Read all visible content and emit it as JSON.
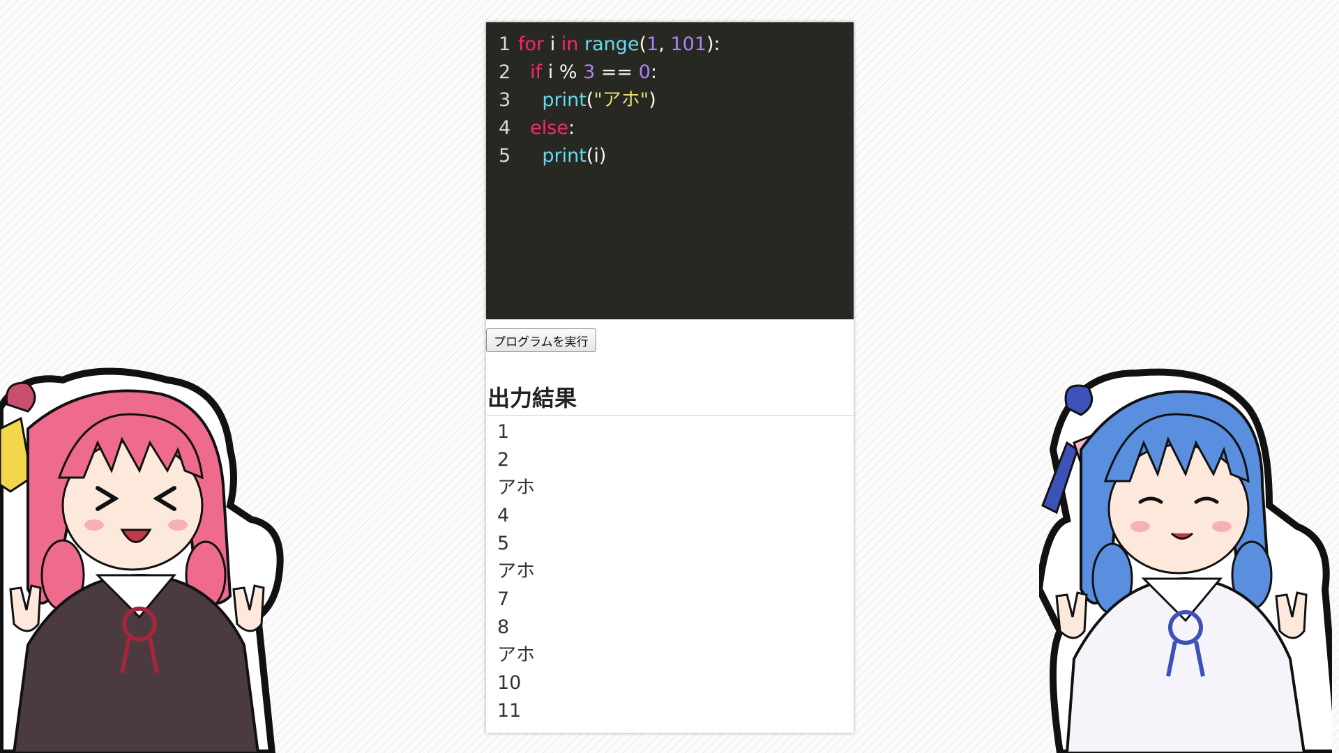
{
  "editor": {
    "lines": [
      {
        "num": "1",
        "tokens": [
          {
            "t": "for",
            "c": "kw"
          },
          {
            "t": " i ",
            "c": "plain"
          },
          {
            "t": "in",
            "c": "kw"
          },
          {
            "t": " ",
            "c": "plain"
          },
          {
            "t": "range",
            "c": "fn"
          },
          {
            "t": "(",
            "c": "plain"
          },
          {
            "t": "1",
            "c": "num"
          },
          {
            "t": ", ",
            "c": "plain"
          },
          {
            "t": "101",
            "c": "num"
          },
          {
            "t": "):",
            "c": "plain"
          }
        ]
      },
      {
        "num": "2",
        "tokens": [
          {
            "t": "  ",
            "c": "plain"
          },
          {
            "t": "if",
            "c": "kw"
          },
          {
            "t": " i % ",
            "c": "plain"
          },
          {
            "t": "3",
            "c": "num"
          },
          {
            "t": " == ",
            "c": "plain"
          },
          {
            "t": "0",
            "c": "num"
          },
          {
            "t": ":",
            "c": "plain"
          }
        ]
      },
      {
        "num": "3",
        "tokens": [
          {
            "t": "    ",
            "c": "plain"
          },
          {
            "t": "print",
            "c": "fn"
          },
          {
            "t": "(",
            "c": "plain"
          },
          {
            "t": "\"アホ\"",
            "c": "str"
          },
          {
            "t": ")",
            "c": "plain"
          }
        ]
      },
      {
        "num": "4",
        "tokens": [
          {
            "t": "  ",
            "c": "plain"
          },
          {
            "t": "else",
            "c": "kw"
          },
          {
            "t": ":",
            "c": "plain"
          }
        ]
      },
      {
        "num": "5",
        "tokens": [
          {
            "t": "    ",
            "c": "plain"
          },
          {
            "t": "print",
            "c": "fn"
          },
          {
            "t": "(i)",
            "c": "plain"
          }
        ]
      }
    ]
  },
  "run_button": {
    "label": "プログラムを実行"
  },
  "output": {
    "heading": "出力結果",
    "lines": [
      "1",
      "2",
      "アホ",
      "4",
      "5",
      "アホ",
      "7",
      "8",
      "アホ",
      "10",
      "11"
    ]
  },
  "characters": {
    "left": {
      "icon": "character-illustration-pink-hair"
    },
    "right": {
      "icon": "character-illustration-blue-hair"
    }
  },
  "colors": {
    "editor_bg": "#272822",
    "keyword": "#f92672",
    "function": "#66d9ef",
    "number": "#ae81ff",
    "string": "#e6db74"
  }
}
